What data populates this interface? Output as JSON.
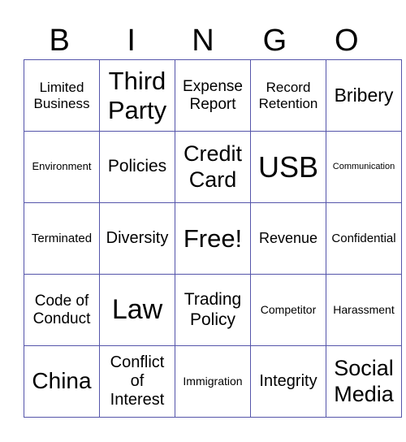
{
  "header": [
    "B",
    "I",
    "N",
    "G",
    "O"
  ],
  "rows": [
    [
      {
        "text": "Limited Business",
        "size": 17
      },
      {
        "text": "Third Party",
        "size": 31
      },
      {
        "text": "Expense Report",
        "size": 19
      },
      {
        "text": "Record Retention",
        "size": 17
      },
      {
        "text": "Bribery",
        "size": 23
      }
    ],
    [
      {
        "text": "Environment",
        "size": 13
      },
      {
        "text": "Policies",
        "size": 21
      },
      {
        "text": "Credit Card",
        "size": 27
      },
      {
        "text": "USB",
        "size": 36
      },
      {
        "text": "Communication",
        "size": 11
      }
    ],
    [
      {
        "text": "Terminated",
        "size": 15
      },
      {
        "text": "Diversity",
        "size": 20
      },
      {
        "text": "Free!",
        "size": 31
      },
      {
        "text": "Revenue",
        "size": 18
      },
      {
        "text": "Confidential",
        "size": 15
      }
    ],
    [
      {
        "text": "Code of Conduct",
        "size": 19
      },
      {
        "text": "Law",
        "size": 34
      },
      {
        "text": "Trading Policy",
        "size": 21
      },
      {
        "text": "Competitor",
        "size": 14
      },
      {
        "text": "Harassment",
        "size": 14
      }
    ],
    [
      {
        "text": "China",
        "size": 28
      },
      {
        "text": "Conflict of Interest",
        "size": 20
      },
      {
        "text": "Immigration",
        "size": 14
      },
      {
        "text": "Integrity",
        "size": 20
      },
      {
        "text": "Social Media",
        "size": 27
      }
    ]
  ]
}
